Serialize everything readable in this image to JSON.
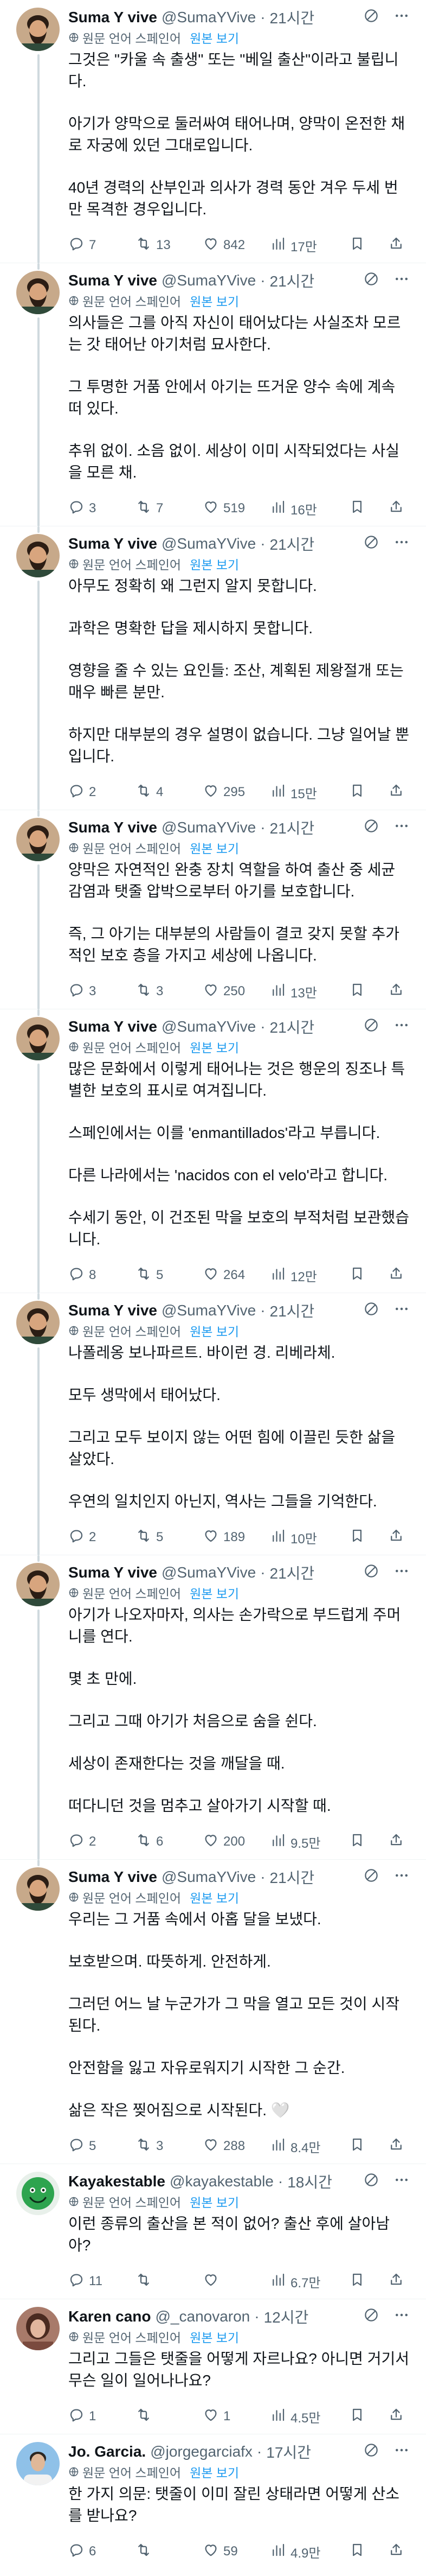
{
  "translate_note": "원문 언어 스페인어",
  "translate_link": "원본 보기",
  "tweets": [
    {
      "name": "Suma Y vive",
      "handle": "@SumaYVive",
      "dot": "·",
      "time": "21시간",
      "translated": true,
      "paragraphs": [
        "그것은 \"카울 속 출생\" 또는 \"베일 출산\"이라고 불립니다.",
        "아기가 양막으로 둘러싸여 태어나며, 양막이 온전한 채로 자궁에 있던 그대로입니다.",
        "40년 경력의 산부인과 의사가 경력 동안 겨우 두세 번만 목격한 경우입니다."
      ],
      "replies": "7",
      "retweets": "13",
      "likes": "842",
      "views": "17만"
    },
    {
      "name": "Suma Y vive",
      "handle": "@SumaYVive",
      "dot": "·",
      "time": "21시간",
      "translated": true,
      "paragraphs": [
        "의사들은 그를 아직 자신이 태어났다는 사실조차 모르는 갓 태어난 아기처럼 묘사한다.",
        "그 투명한 거품 안에서 아기는 뜨거운 양수 속에 계속 떠 있다.",
        "추위 없이. 소음 없이. 세상이 이미 시작되었다는 사실을 모른 채."
      ],
      "replies": "3",
      "retweets": "7",
      "likes": "519",
      "views": "16만"
    },
    {
      "name": "Suma Y vive",
      "handle": "@SumaYVive",
      "dot": "·",
      "time": "21시간",
      "translated": true,
      "paragraphs": [
        "아무도 정확히 왜 그런지 알지 못합니다.",
        "과학은 명확한 답을 제시하지 못합니다.",
        "영향을 줄 수 있는 요인들: 조산, 계획된 제왕절개 또는 매우 빠른 분만.",
        "하지만 대부분의 경우 설명이 없습니다. 그냥 일어날 뿐입니다."
      ],
      "replies": "2",
      "retweets": "4",
      "likes": "295",
      "views": "15만"
    },
    {
      "name": "Suma Y vive",
      "handle": "@SumaYVive",
      "dot": "·",
      "time": "21시간",
      "translated": true,
      "paragraphs": [
        "양막은 자연적인 완충 장치 역할을 하여 출산 중 세균 감염과 탯줄 압박으로부터 아기를 보호합니다.",
        "즉, 그 아기는 대부분의 사람들이 결코 갖지 못할 추가적인 보호 층을 가지고 세상에 나옵니다."
      ],
      "replies": "3",
      "retweets": "3",
      "likes": "250",
      "views": "13만"
    },
    {
      "name": "Suma Y vive",
      "handle": "@SumaYVive",
      "dot": "·",
      "time": "21시간",
      "translated": true,
      "paragraphs": [
        "많은 문화에서 이렇게 태어나는 것은 행운의 징조나 특별한 보호의 표시로 여겨집니다.",
        "스페인에서는 이를 'enmantillados'라고 부릅니다.",
        "다른 나라에서는 'nacidos con el velo'라고 합니다.",
        "수세기 동안, 이 건조된 막을 보호의 부적처럼 보관했습니다."
      ],
      "replies": "8",
      "retweets": "5",
      "likes": "264",
      "views": "12만"
    },
    {
      "name": "Suma Y vive",
      "handle": "@SumaYVive",
      "dot": "·",
      "time": "21시간",
      "translated": true,
      "paragraphs": [
        "나폴레옹 보나파르트. 바이런 경. 리베라체.",
        "모두 생막에서 태어났다.",
        "그리고 모두 보이지 않는 어떤 힘에 이끌린 듯한 삶을 살았다.",
        "우연의 일치인지 아닌지, 역사는 그들을 기억한다."
      ],
      "replies": "2",
      "retweets": "5",
      "likes": "189",
      "views": "10만"
    },
    {
      "name": "Suma Y vive",
      "handle": "@SumaYVive",
      "dot": "·",
      "time": "21시간",
      "translated": true,
      "paragraphs": [
        "아기가 나오자마자, 의사는 손가락으로 부드럽게 주머니를 연다.",
        "몇 초 만에.",
        "그리고 그때 아기가 처음으로 숨을 쉰다.",
        "세상이 존재한다는 것을 깨달을 때.",
        "떠다니던 것을 멈추고 살아가기 시작할 때."
      ],
      "replies": "2",
      "retweets": "6",
      "likes": "200",
      "views": "9.5만"
    },
    {
      "name": "Suma Y vive",
      "handle": "@SumaYVive",
      "dot": "·",
      "time": "21시간",
      "translated": true,
      "paragraphs": [
        "우리는 그 거품 속에서 아홉 달을 보냈다.",
        "보호받으며. 따뜻하게. 안전하게.",
        "그러던 어느 날 누군가가 그 막을 열고 모든 것이 시작된다.",
        "안전함을 잃고 자유로워지기 시작한 그 순간.",
        "삶은 작은 찢어짐으로 시작된다. 🤍"
      ],
      "replies": "5",
      "retweets": "3",
      "likes": "288",
      "views": "8.4만"
    },
    {
      "name": "Kayakestable",
      "handle": "@kayakestable",
      "dot": "·",
      "time": "18시간",
      "translated": true,
      "paragraphs": [
        "이런 종류의 출산을 본 적이 없어? 출산 후에 살아남아?"
      ],
      "replies": "11",
      "retweets": "",
      "likes": "",
      "views": "6.7만"
    },
    {
      "name": "Karen cano",
      "handle": "@_canovaron",
      "dot": "·",
      "time": "12시간",
      "translated": true,
      "paragraphs": [
        "그리고 그들은 탯줄을 어떻게 자르나요? 아니면 거기서 무슨 일이 일어나나요?"
      ],
      "replies": "1",
      "retweets": "",
      "likes": "1",
      "views": "4.5만"
    },
    {
      "name": "Jo. Garcia.",
      "handle": "@jorgegarciafx",
      "dot": "·",
      "time": "17시간",
      "translated": true,
      "paragraphs": [
        "한 가지 의문: 탯줄이 이미 잘린 상태라면 어떻게 산소를 받나요?"
      ],
      "replies": "6",
      "retweets": "",
      "likes": "59",
      "views": "4.9만"
    }
  ],
  "colors": {
    "accent": "#1d9bf0",
    "secondary_text": "#536471",
    "thread_line": "#cfd9de",
    "divider": "#eff3f4"
  },
  "icons": {
    "globe": "globe-icon",
    "grok": "grok-icon",
    "more": "more-icon",
    "reply": "reply-icon",
    "retweet": "retweet-icon",
    "like": "heart-icon",
    "views": "views-icon",
    "bookmark": "bookmark-icon",
    "share": "share-icon"
  }
}
